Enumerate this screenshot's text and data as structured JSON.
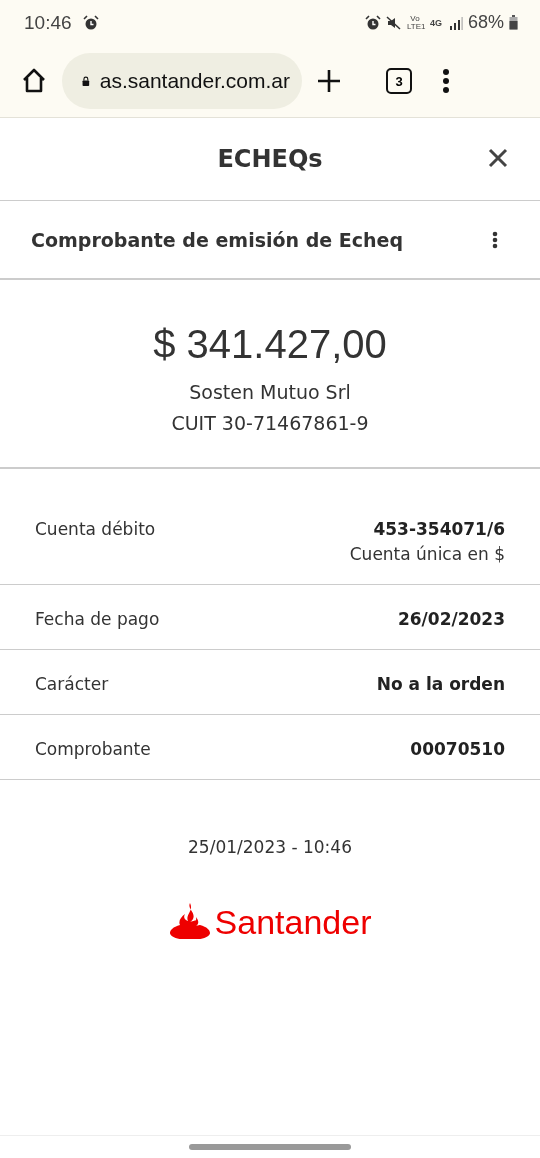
{
  "status_bar": {
    "time": "10:46",
    "network_volte": "Vo LTE1",
    "network_type": "4G",
    "battery": "68%"
  },
  "browser": {
    "url": "as.santander.com.ar",
    "tab_count": "3"
  },
  "header": {
    "title": "ECHEQs"
  },
  "subheader": {
    "title": "Comprobante de emisión de Echeq"
  },
  "summary": {
    "amount": "$ 341.427,00",
    "name": "Sosten Mutuo Srl",
    "cuit": "CUIT 30-71467861-9"
  },
  "details": [
    {
      "label": "Cuenta débito",
      "value": "453-354071/6",
      "note": "Cuenta única en $"
    },
    {
      "label": "Fecha de pago",
      "value": "26/02/2023"
    },
    {
      "label": "Carácter",
      "value": "No a la orden"
    },
    {
      "label": "Comprobante",
      "value": "00070510"
    }
  ],
  "timestamp": "25/01/2023 - 10:46",
  "brand": "Santander"
}
